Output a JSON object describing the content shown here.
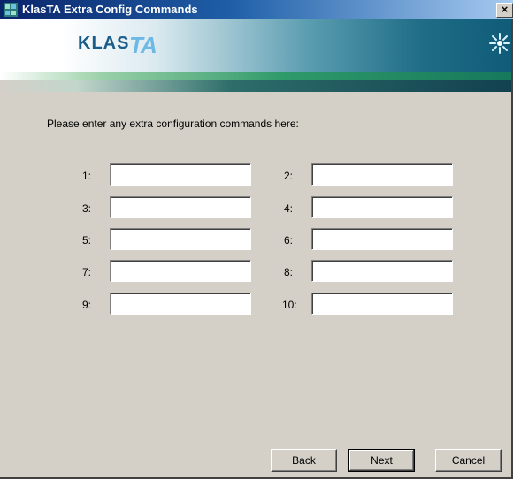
{
  "window": {
    "title": "KlasTA Extra Config Commands",
    "close_label": "×"
  },
  "banner": {
    "logo_klas": "KLAS",
    "logo_ta": "TA"
  },
  "prompt": "Please enter any extra configuration commands here:",
  "fields": [
    {
      "label": "1:",
      "value": ""
    },
    {
      "label": "2:",
      "value": ""
    },
    {
      "label": "3:",
      "value": ""
    },
    {
      "label": "4:",
      "value": ""
    },
    {
      "label": "5:",
      "value": ""
    },
    {
      "label": "6:",
      "value": ""
    },
    {
      "label": "7:",
      "value": ""
    },
    {
      "label": "8:",
      "value": ""
    },
    {
      "label": "9:",
      "value": ""
    },
    {
      "label": "10:",
      "value": ""
    }
  ],
  "buttons": {
    "back": "Back",
    "next": "Next",
    "cancel": "Cancel"
  },
  "colors": {
    "titlebar": "#0a246a",
    "dialog_face": "#d4d0c8",
    "brand_teal": "#0f5b78"
  }
}
